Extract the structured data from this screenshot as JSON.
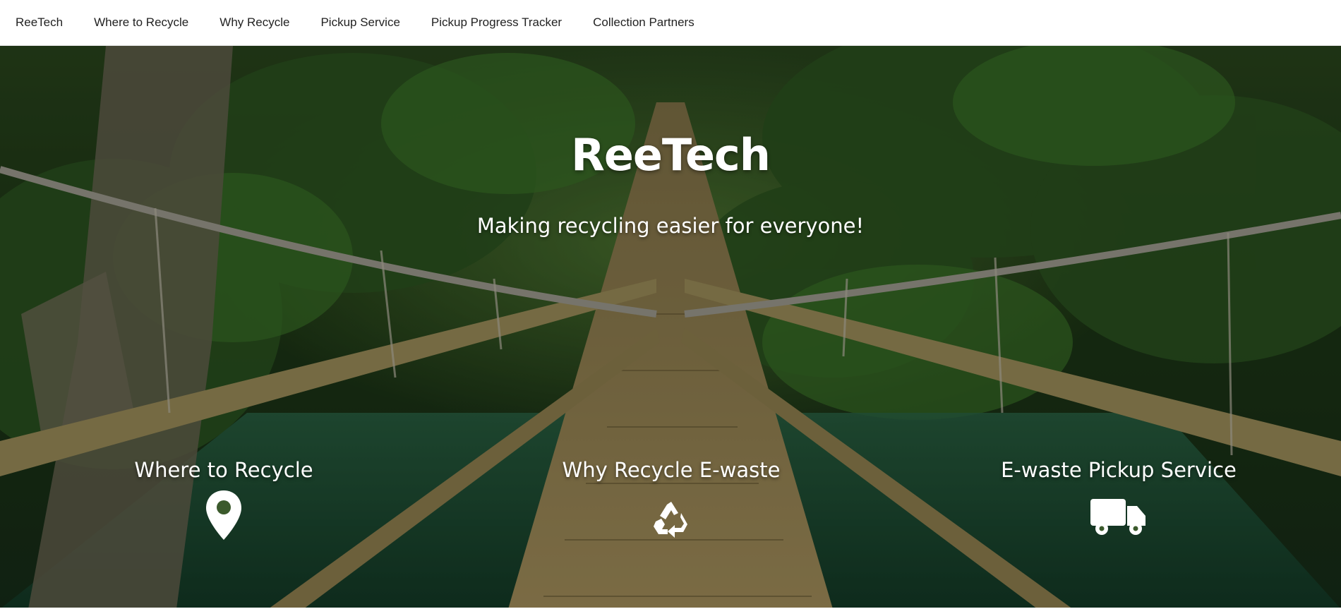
{
  "nav": {
    "brand": "ReeTech",
    "items": [
      {
        "label": "Where to Recycle"
      },
      {
        "label": "Why Recycle"
      },
      {
        "label": "Pickup Service"
      },
      {
        "label": "Pickup Progress Tracker"
      },
      {
        "label": "Collection Partners"
      }
    ]
  },
  "hero": {
    "title": "ReeTech",
    "tagline": "Making recycling easier for everyone!",
    "background": "jungle-rope-bridge-photo",
    "features": [
      {
        "label": "Where to Recycle",
        "icon": "map-pin-icon"
      },
      {
        "label": "Why Recycle E-waste",
        "icon": "recycle-icon"
      },
      {
        "label": "E-waste Pickup Service",
        "icon": "truck-icon"
      }
    ]
  },
  "colors": {
    "nav_bg": "#ffffff",
    "nav_text": "#222222",
    "hero_text": "#ffffff",
    "overlay": "rgba(0,0,0,0.30)"
  }
}
